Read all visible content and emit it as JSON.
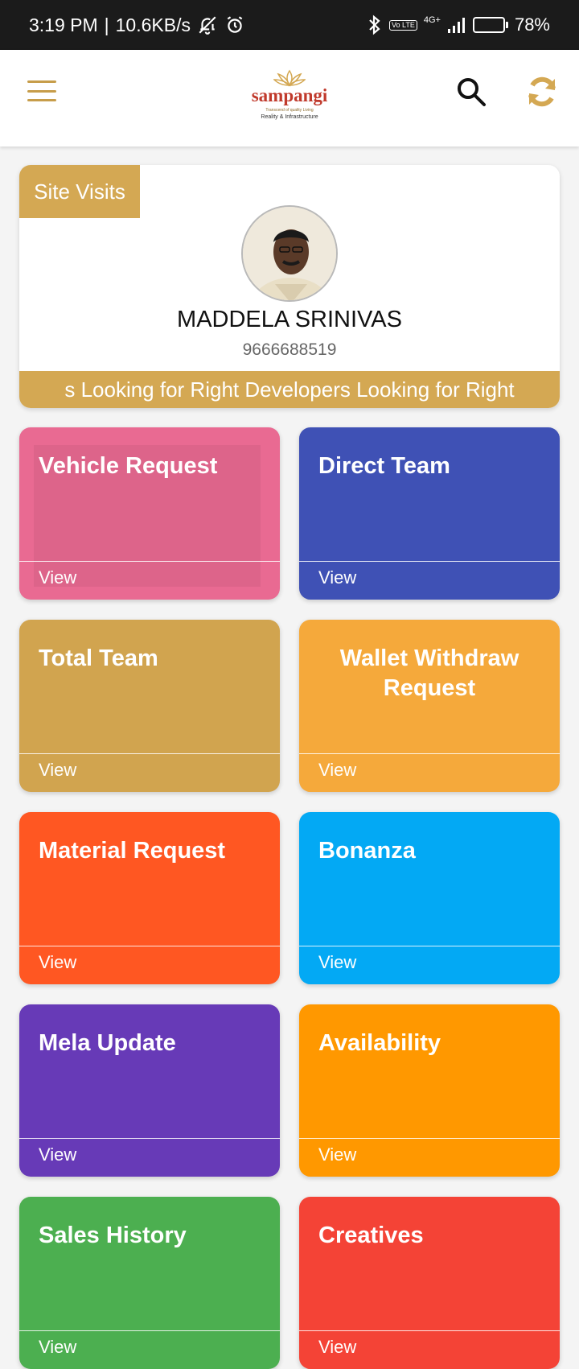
{
  "status_bar": {
    "time": "3:19 PM",
    "speed": "10.6KB/s",
    "lte_label": "Vo LTE",
    "network_type": "4G+",
    "battery_percent": "78%",
    "battery_level": 0.78
  },
  "app_bar": {
    "logo_text": "sampangi",
    "logo_tagline": "Transcend of quality Living",
    "logo_subtitle": "Reality & Infrastructure",
    "icons": [
      "menu-icon",
      "search-icon",
      "refresh-icon"
    ],
    "accent_color": "#c79d4a"
  },
  "profile": {
    "badge_label": "Site Visits",
    "name": "MADDELA SRINIVAS",
    "phone": "9666688519",
    "marquee_text": "s Looking for Right Developers Looking for Right"
  },
  "tiles": [
    {
      "title": "Vehicle Request",
      "view": "View",
      "color": "#e96a92"
    },
    {
      "title": "Direct Team",
      "view": "View",
      "color": "#3f51b5"
    },
    {
      "title": "Total Team",
      "view": "View",
      "color": "#d1a44f"
    },
    {
      "title": "Wallet Withdraw Request",
      "view": "View",
      "color": "#f5a93b"
    },
    {
      "title": "Material Request",
      "view": "View",
      "color": "#ff5722"
    },
    {
      "title": "Bonanza",
      "view": "View",
      "color": "#03a9f4"
    },
    {
      "title": "Mela Update",
      "view": "View",
      "color": "#673ab7"
    },
    {
      "title": "Availability",
      "view": "View",
      "color": "#ff9800"
    },
    {
      "title": "Sales History",
      "view": "View",
      "color": "#4caf50"
    },
    {
      "title": "Creatives",
      "view": "View",
      "color": "#f44336"
    }
  ]
}
